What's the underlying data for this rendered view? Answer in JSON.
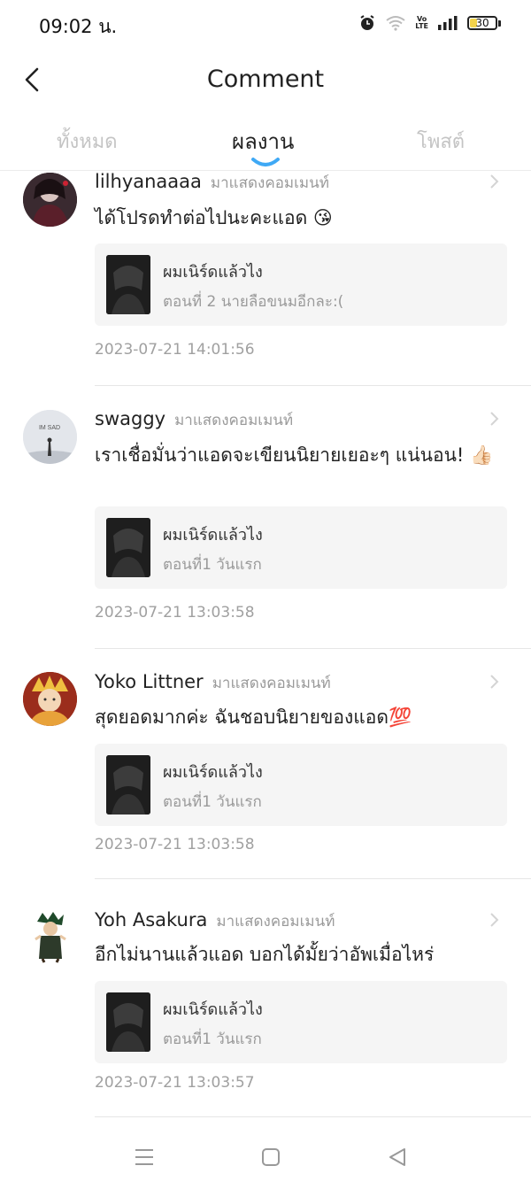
{
  "status": {
    "time": "09:02 น.",
    "battery": "30",
    "battery_level": 0.3,
    "volte": "Vo",
    "lte": "LTE"
  },
  "header": {
    "title": "Comment"
  },
  "tabs": [
    {
      "label": "ทั้งหมด",
      "active": false
    },
    {
      "label": "ผลงาน",
      "active": true
    },
    {
      "label": "โพสต์",
      "active": false
    }
  ],
  "colors": {
    "accent": "#3fa9f5",
    "subtext": "#9a9a9a"
  },
  "comments": [
    {
      "user": "lilhyanaaaa",
      "tag": "มาแสดงคอมเมนท์",
      "text": "ได้โปรดทำต่อไปนะคะแอด 😘",
      "work_title": "ผมเนิร์ดแล้วไง",
      "work_episode": "ตอนที่ 2 นายลือขนมอีกละ:(",
      "timestamp": "2023-07-21 14:01:56"
    },
    {
      "user": "swaggy",
      "tag": "มาแสดงคอมเมนท์",
      "text": "เราเชื่อมั่นว่าแอดจะเขียนนิยายเยอะๆ แน่นอน! 👍🏻",
      "avatar_caption": "IM SAD",
      "work_title": "ผมเนิร์ดแล้วไง",
      "work_episode": "ตอนที่1 วันแรก",
      "timestamp": "2023-07-21 13:03:58"
    },
    {
      "user": "Yoko Littner",
      "tag": "มาแสดงคอมเมนท์",
      "text": "สุดยอดมากค่ะ ฉันชอบนิยายของแอด💯",
      "work_title": "ผมเนิร์ดแล้วไง",
      "work_episode": "ตอนที่1 วันแรก",
      "timestamp": "2023-07-21 13:03:58"
    },
    {
      "user": "Yoh Asakura",
      "tag": "มาแสดงคอมเมนท์",
      "text": "อีกไม่นานแล้วแอด บอกได้มั้ยว่าอัพเมื่อไหร่",
      "work_title": "ผมเนิร์ดแล้วไง",
      "work_episode": "ตอนที่1 วันแรก",
      "timestamp": "2023-07-21 13:03:57"
    }
  ],
  "navbar": {
    "icons": [
      "menu-icon",
      "home-square-icon",
      "back-triangle-icon"
    ]
  }
}
